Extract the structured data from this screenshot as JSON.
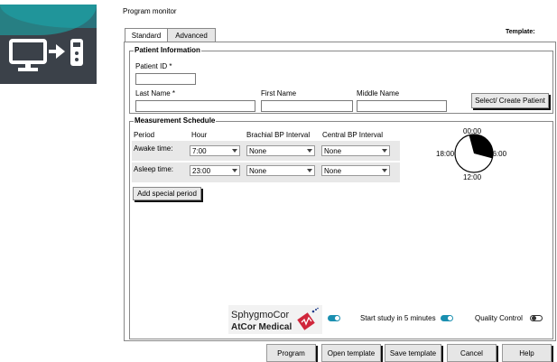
{
  "window": {
    "title": "Program monitor",
    "template_label": "Template:"
  },
  "tabs": [
    "Standard",
    "Advanced"
  ],
  "patient": {
    "legend": "Patient Information",
    "id_label": "Patient ID *",
    "last_name_label": "Last Name *",
    "first_name_label": "First Name",
    "middle_name_label": "Middle Name",
    "select_button": "Select/ Create Patient"
  },
  "schedule": {
    "legend": "Measurement Schedule",
    "headers": {
      "period": "Period",
      "hour": "Hour",
      "brachial": "Brachial BP Interval",
      "central": "Central BP Interval"
    },
    "rows": [
      {
        "period": "Awake time:",
        "hour": "7:00",
        "brachial": "None",
        "central": "None"
      },
      {
        "period": "Asleep time:",
        "hour": "23:00",
        "brachial": "None",
        "central": "None"
      }
    ],
    "add_button": "Add special period",
    "clock": {
      "top": "00:00",
      "right": "06:00",
      "bottom": "12:00",
      "left": "18:00",
      "asleep_start_hour": 23,
      "asleep_end_hour": 7
    }
  },
  "footer": {
    "logo_line1": "SphygmoCor",
    "logo_line2": "AtCor Medical",
    "start_study_label": "Start study in 5 minutes",
    "quality_control_label": "Quality Control",
    "logo_toggle_on": true,
    "start_study_on": true,
    "quality_control_on": false
  },
  "buttons": [
    "Program",
    "Open template",
    "Save template",
    "Cancel",
    "Help"
  ],
  "colors": {
    "accent": "#1a8fb0",
    "logo_red": "#d0263b",
    "icon_bg": "#3b4149"
  }
}
